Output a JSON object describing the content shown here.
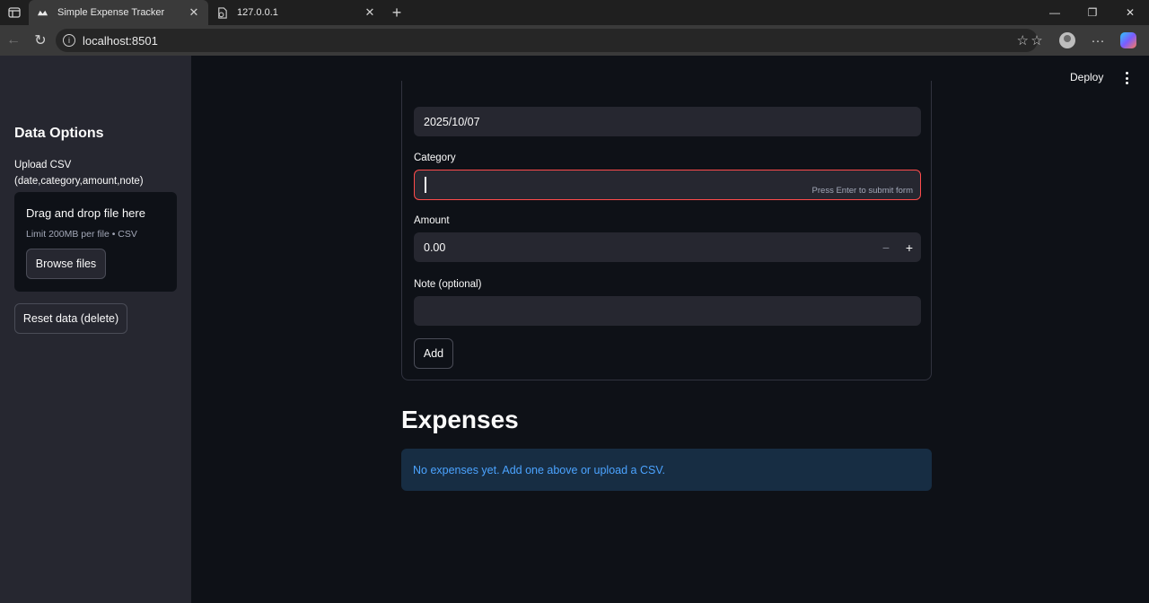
{
  "browser": {
    "tabs": [
      {
        "title": "Simple Expense Tracker",
        "active": true
      },
      {
        "title": "127.0.0.1",
        "active": false
      }
    ],
    "address": "localhost:8501"
  },
  "header": {
    "deploy_label": "Deploy"
  },
  "sidebar": {
    "title": "Data Options",
    "upload_label": "Upload CSV (date,category,amount,note)",
    "dropzone_main": "Drag and drop file here",
    "dropzone_sub": "Limit 200MB per file • CSV",
    "browse_label": "Browse files",
    "reset_label": "Reset data (delete)"
  },
  "form": {
    "date_value": "2025/10/07",
    "category_label": "Category",
    "category_value": "",
    "category_hint": "Press Enter to submit form",
    "amount_label": "Amount",
    "amount_value": "0.00",
    "minus_symbol": "−",
    "plus_symbol": "+",
    "note_label": "Note (optional)",
    "note_value": "",
    "add_label": "Add"
  },
  "expenses": {
    "heading": "Expenses",
    "empty_message": "No expenses yet. Add one above or upload a CSV."
  },
  "colors": {
    "background": "#0e1117",
    "sidebar": "#262730",
    "error_border": "#ff4b4b",
    "info_bg": "#172d43",
    "info_text": "#4ba3ff"
  }
}
